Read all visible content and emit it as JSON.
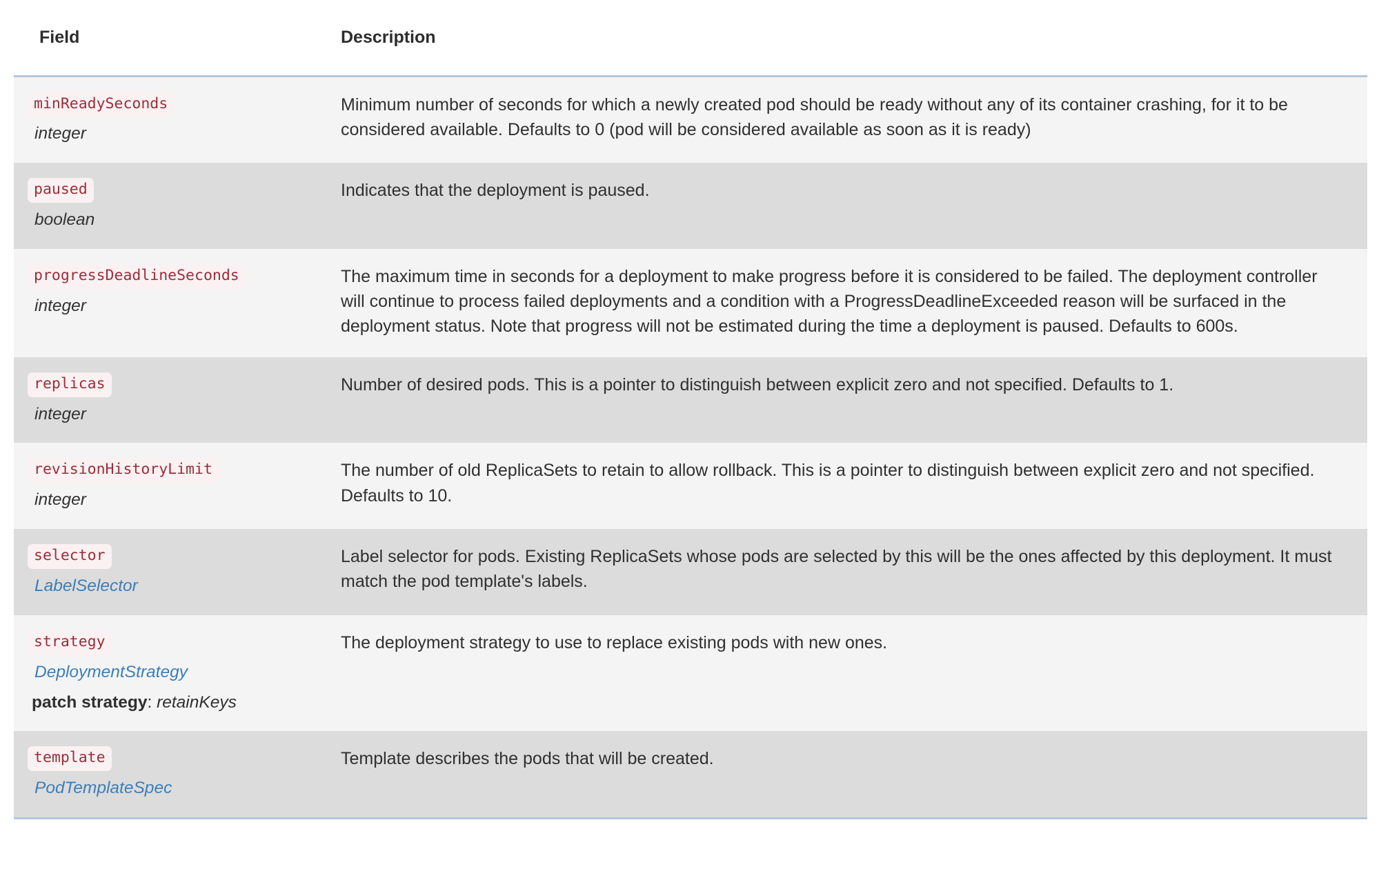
{
  "table": {
    "columns": [
      {
        "key": "field",
        "label": "Field"
      },
      {
        "key": "description",
        "label": "Description"
      }
    ],
    "accent_border_color": "#b3c6dd",
    "row_colors": {
      "light": "#f4f4f4",
      "dark": "#dcdcdc"
    },
    "code_colors": {
      "text": "#9c2d3b",
      "background": "#faf1f2"
    },
    "link_color": "#3d7eb8",
    "rows": [
      {
        "name": "minReadySeconds",
        "type": "integer",
        "type_is_link": false,
        "patch_label": null,
        "patch_value": null,
        "description": "Minimum number of seconds for which a newly created pod should be ready without any of its container crashing, for it to be considered available. Defaults to 0 (pod will be considered available as soon as it is ready)"
      },
      {
        "name": "paused",
        "type": "boolean",
        "type_is_link": false,
        "patch_label": null,
        "patch_value": null,
        "description": "Indicates that the deployment is paused."
      },
      {
        "name": "progressDeadlineSeconds",
        "type": "integer",
        "type_is_link": false,
        "patch_label": null,
        "patch_value": null,
        "description": "The maximum time in seconds for a deployment to make progress before it is considered to be failed. The deployment controller will continue to process failed deployments and a condition with a ProgressDeadlineExceeded reason will be surfaced in the deployment status. Note that progress will not be estimated during the time a deployment is paused. Defaults to 600s."
      },
      {
        "name": "replicas",
        "type": "integer",
        "type_is_link": false,
        "patch_label": null,
        "patch_value": null,
        "description": "Number of desired pods. This is a pointer to distinguish between explicit zero and not specified. Defaults to 1."
      },
      {
        "name": "revisionHistoryLimit",
        "type": "integer",
        "type_is_link": false,
        "patch_label": null,
        "patch_value": null,
        "description": "The number of old ReplicaSets to retain to allow rollback. This is a pointer to distinguish between explicit zero and not specified. Defaults to 10."
      },
      {
        "name": "selector",
        "type": "LabelSelector",
        "type_is_link": true,
        "patch_label": null,
        "patch_value": null,
        "description": "Label selector for pods. Existing ReplicaSets whose pods are selected by this will be the ones affected by this deployment. It must match the pod template's labels."
      },
      {
        "name": "strategy",
        "type": "DeploymentStrategy",
        "type_is_link": true,
        "patch_label": "patch strategy",
        "patch_value": "retainKeys",
        "description": "The deployment strategy to use to replace existing pods with new ones."
      },
      {
        "name": "template",
        "type": "PodTemplateSpec",
        "type_is_link": true,
        "patch_label": null,
        "patch_value": null,
        "description": "Template describes the pods that will be created."
      }
    ]
  }
}
